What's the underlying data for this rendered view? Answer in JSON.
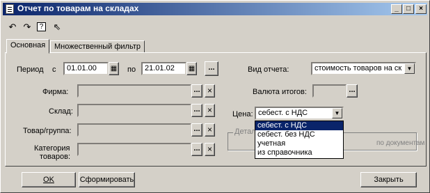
{
  "window": {
    "title": "Отчет по товарам на складах",
    "controls": {
      "minimize": "_",
      "maximize": "□",
      "close": "×"
    }
  },
  "toolbar": {
    "tools": [
      "undo-icon",
      "redo-icon",
      "help-icon",
      "whats-this-icon"
    ]
  },
  "tabs": [
    {
      "label": "Основная",
      "active": true
    },
    {
      "label": "Множественный фильтр",
      "active": false
    }
  ],
  "period": {
    "label_period": "Период",
    "label_from": "с",
    "from_value": "01.01.00",
    "label_to": "по",
    "to_value": "21.01.02",
    "more_button": "..."
  },
  "filters": {
    "firm_label": "Фирма:",
    "warehouse_label": "Склад:",
    "product_label": "Товар/группа:",
    "category_label_1": "Категория",
    "category_label_2": "товаров:",
    "select_button": "...",
    "clear_button": "×"
  },
  "report": {
    "type_label": "Вид отчета:",
    "type_value": "стоимость товаров на ск",
    "currency_label": "Валюта итогов:",
    "currency_value": "",
    "price_label": "Цена:",
    "price_value": "себест. с НДС",
    "price_options": [
      "себест. с НДС",
      "себест. без НДС",
      "учетная",
      "из справочника"
    ],
    "price_selected_index": 0
  },
  "details_group": {
    "title": "Детал",
    "right_text": "по документам"
  },
  "footer": {
    "ok_label": "OK",
    "generate_label": "Сформировать",
    "close_label": "Закрыть"
  }
}
